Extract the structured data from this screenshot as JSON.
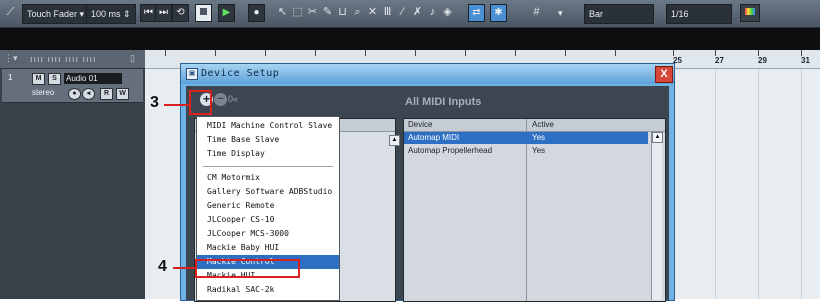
{
  "toolbar": {
    "automation_mode": "Touch Fader",
    "latency": "100 ms",
    "snap_type": "Bar",
    "quantize": "1/16"
  },
  "ruler": {
    "bars": [
      "25",
      "27",
      "29",
      "31"
    ]
  },
  "track": {
    "number": "1",
    "name": "Audio 01",
    "channel": "stereo",
    "mute": "M",
    "solo": "S",
    "read": "R",
    "write": "W"
  },
  "dialog": {
    "title": "Device Setup",
    "close_label": "X",
    "add_label": "+",
    "remove_label": "−",
    "reset_label": "0",
    "panel_title": "All MIDI Inputs",
    "table": {
      "headers": [
        "Device",
        "Active"
      ],
      "rows": [
        {
          "device": "Automap MIDI",
          "active": "Yes",
          "selected": true
        },
        {
          "device": "Automap Propellerhead",
          "active": "Yes",
          "selected": false
        }
      ]
    }
  },
  "menu": {
    "items": [
      "MIDI Machine Control Slave",
      "Time Base Slave",
      "Time Display",
      "CM Motormix",
      "Gallery Software ADBStudio",
      "Generic Remote",
      "JLCooper CS-10",
      "JLCooper MCS-3000",
      "Mackie Baby HUI",
      "Mackie Control",
      "Mackie HUI",
      "Radikal SAC-2k"
    ],
    "selected": "Mackie Control"
  },
  "callouts": {
    "step3": "3",
    "step4": "4"
  },
  "colors": {
    "accent_red": "#d9221d",
    "selection_blue": "#2d6fc2",
    "dialog_frame": "#6fb3e6"
  }
}
